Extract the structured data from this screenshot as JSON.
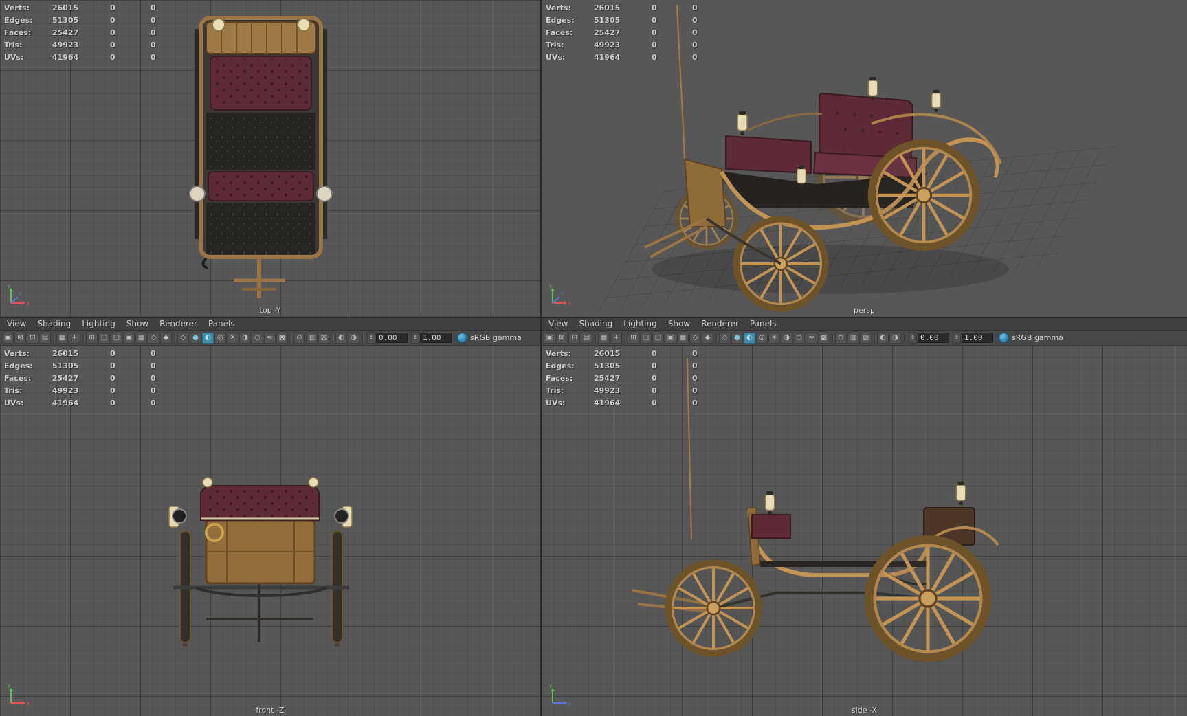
{
  "hud": {
    "rows": [
      {
        "label": "Verts:",
        "value": "26015",
        "c2": "0",
        "c3": "0"
      },
      {
        "label": "Edges:",
        "value": "51305",
        "c2": "0",
        "c3": "0"
      },
      {
        "label": "Faces:",
        "value": "25427",
        "c2": "0",
        "c3": "0"
      },
      {
        "label": "Tris:",
        "value": "49923",
        "c2": "0",
        "c3": "0"
      },
      {
        "label": "UVs:",
        "value": "41964",
        "c2": "0",
        "c3": "0"
      }
    ]
  },
  "menu": {
    "items": [
      "View",
      "Shading",
      "Lighting",
      "Show",
      "Renderer",
      "Panels"
    ]
  },
  "toolbar": {
    "exposure_value": "0.00",
    "gamma_value": "1.00",
    "view_transform": "sRGB gamma",
    "icons": [
      {
        "name": "select-camera",
        "glyph": "▣"
      },
      {
        "name": "lock-camera",
        "glyph": "⊠"
      },
      {
        "name": "camera-attributes",
        "glyph": "⊡"
      },
      {
        "name": "bookmarks",
        "glyph": "▤",
        "sep": true
      },
      {
        "name": "image-plane",
        "glyph": "▦"
      },
      {
        "name": "pan-zoom-2d",
        "glyph": "+",
        "sep": true
      },
      {
        "name": "grid-toggle",
        "glyph": "⊞"
      },
      {
        "name": "film-gate",
        "glyph": "□"
      },
      {
        "name": "resolution-gate",
        "glyph": "▢"
      },
      {
        "name": "gate-mask",
        "glyph": "▣"
      },
      {
        "name": "field-chart",
        "glyph": "▦"
      },
      {
        "name": "safe-action",
        "glyph": "◇"
      },
      {
        "name": "safe-title",
        "glyph": "◆",
        "sep": true
      },
      {
        "name": "wireframe",
        "glyph": "◇"
      },
      {
        "name": "smooth-shade",
        "glyph": "●",
        "color": "#7fc4e0"
      },
      {
        "name": "textured",
        "glyph": "◐",
        "color": "#bfe2f0",
        "active": true
      },
      {
        "name": "use-default-material",
        "glyph": "◎"
      },
      {
        "name": "lighting-all",
        "glyph": "☀"
      },
      {
        "name": "shadows",
        "glyph": "◑"
      },
      {
        "name": "occlusion",
        "glyph": "○"
      },
      {
        "name": "motion-blur",
        "glyph": "≈"
      },
      {
        "name": "multisample-aa",
        "glyph": "▩",
        "sep": true
      },
      {
        "name": "isolate-select",
        "glyph": "⊙"
      },
      {
        "name": "xray",
        "glyph": "▥"
      },
      {
        "name": "wireframe-on-shaded",
        "glyph": "▨",
        "sep": true
      },
      {
        "name": "exposure",
        "glyph": "◐"
      },
      {
        "name": "gamma",
        "glyph": "◑"
      }
    ]
  },
  "viewports": {
    "top": {
      "label": "top -Y"
    },
    "persp": {
      "label": "persp"
    },
    "front": {
      "label": "front -Z"
    },
    "side": {
      "label": "side -X"
    }
  },
  "colors": {
    "viewport_bg": "#575757",
    "grid_line": "#454545",
    "menubar_bg": "#3e4042",
    "toolbar_bg": "#47494a",
    "hud_text": "#cbcbcb",
    "active_icon": "#3f8cad",
    "axis_x": "#e05555",
    "axis_y": "#58c554",
    "axis_z": "#5878e0",
    "carriage_wood": "#c49455",
    "carriage_maroon": "#5d2a36",
    "carriage_cream": "#e7dcb4"
  }
}
